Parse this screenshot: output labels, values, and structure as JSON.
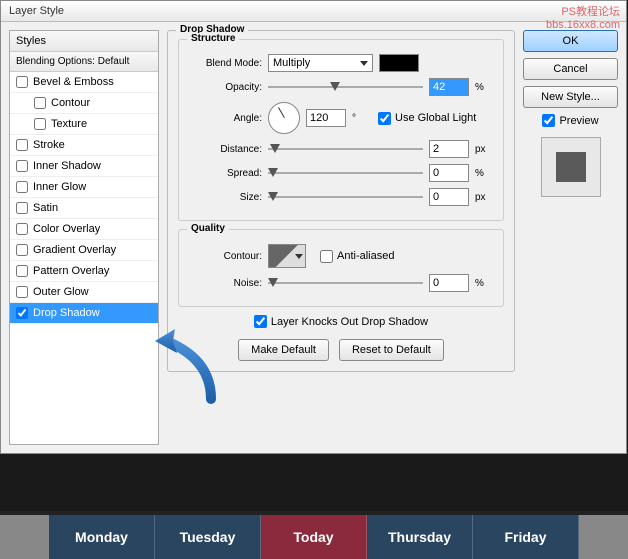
{
  "window": {
    "title": "Layer Style"
  },
  "watermark": {
    "line1": "PS教程论坛",
    "line2": "bbs.16xx8.com"
  },
  "bg_text": "Tuesday",
  "styles_panel": {
    "header": "Styles",
    "blending": "Blending Options: Default",
    "items": [
      {
        "label": "Bevel & Emboss",
        "checked": false,
        "indent": false
      },
      {
        "label": "Contour",
        "checked": false,
        "indent": true
      },
      {
        "label": "Texture",
        "checked": false,
        "indent": true
      },
      {
        "label": "Stroke",
        "checked": false,
        "indent": false
      },
      {
        "label": "Inner Shadow",
        "checked": false,
        "indent": false
      },
      {
        "label": "Inner Glow",
        "checked": false,
        "indent": false
      },
      {
        "label": "Satin",
        "checked": false,
        "indent": false
      },
      {
        "label": "Color Overlay",
        "checked": false,
        "indent": false
      },
      {
        "label": "Gradient Overlay",
        "checked": false,
        "indent": false
      },
      {
        "label": "Pattern Overlay",
        "checked": false,
        "indent": false
      },
      {
        "label": "Outer Glow",
        "checked": false,
        "indent": false
      },
      {
        "label": "Drop Shadow",
        "checked": true,
        "indent": false,
        "selected": true
      }
    ]
  },
  "drop_shadow": {
    "title": "Drop Shadow",
    "structure": {
      "title": "Structure",
      "blend_mode_label": "Blend Mode:",
      "blend_mode_value": "Multiply",
      "shadow_color": "#000000",
      "opacity_label": "Opacity:",
      "opacity_value": "42",
      "opacity_unit": "%",
      "angle_label": "Angle:",
      "angle_value": "120",
      "angle_unit": "°",
      "global_light_label": "Use Global Light",
      "global_light_checked": true,
      "distance_label": "Distance:",
      "distance_value": "2",
      "distance_unit": "px",
      "spread_label": "Spread:",
      "spread_value": "0",
      "spread_unit": "%",
      "size_label": "Size:",
      "size_value": "0",
      "size_unit": "px"
    },
    "quality": {
      "title": "Quality",
      "contour_label": "Contour:",
      "anti_aliased_label": "Anti-aliased",
      "anti_aliased_checked": false,
      "noise_label": "Noise:",
      "noise_value": "0",
      "noise_unit": "%"
    },
    "knockout_label": "Layer Knocks Out Drop Shadow",
    "knockout_checked": true,
    "make_default": "Make Default",
    "reset_default": "Reset to Default"
  },
  "buttons": {
    "ok": "OK",
    "cancel": "Cancel",
    "new_style": "New Style...",
    "preview": "Preview",
    "preview_checked": true
  },
  "days": [
    {
      "label": "Monday",
      "cls": "blue"
    },
    {
      "label": "Tuesday",
      "cls": "blue"
    },
    {
      "label": "Today",
      "cls": "red"
    },
    {
      "label": "Thursday",
      "cls": "blue"
    },
    {
      "label": "Friday",
      "cls": "blue"
    }
  ]
}
